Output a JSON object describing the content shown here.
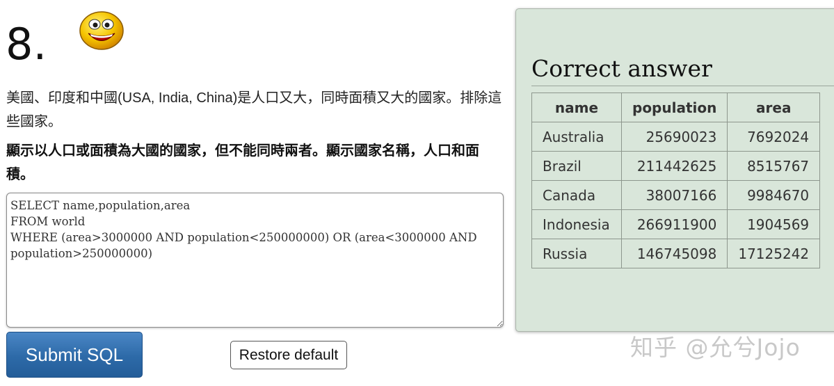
{
  "question": {
    "number": "8.",
    "description": "美國、印度和中國(USA, India, China)是人口又大，同時面積又大的國家。排除這些國家。",
    "instruction": "顯示以人口或面積為大國的國家，但不能同時兩者。顯示國家名稱，人口和面積。"
  },
  "editor": {
    "sql": "SELECT name,population,area\nFROM world\nWHERE (area>3000000 AND population<250000000) OR (area<3000000 AND population>250000000)"
  },
  "buttons": {
    "submit": "Submit SQL",
    "restore": "Restore default"
  },
  "answer": {
    "title": "Correct answer",
    "columns": [
      "name",
      "population",
      "area"
    ],
    "rows": [
      [
        "Australia",
        "25690023",
        "7692024"
      ],
      [
        "Brazil",
        "211442625",
        "8515767"
      ],
      [
        "Canada",
        "38007166",
        "9984670"
      ],
      [
        "Indonesia",
        "266911900",
        "1904569"
      ],
      [
        "Russia",
        "146745098",
        "17125242"
      ]
    ]
  },
  "watermark": "知乎 @允兮Jojo",
  "colors": {
    "panel_bg": "#d9e6da",
    "submit_bg": "#2d6aa8",
    "smiley": "#f5c400"
  }
}
